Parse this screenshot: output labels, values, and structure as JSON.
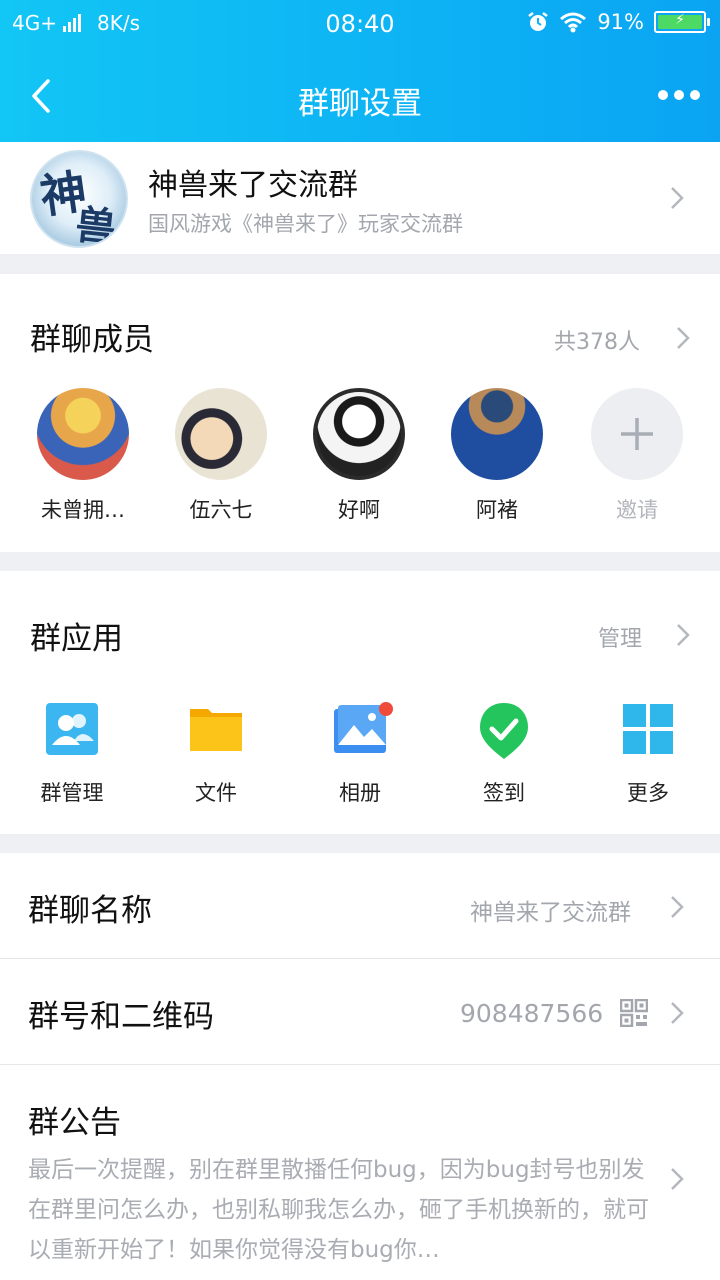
{
  "status_bar": {
    "network": "4G+",
    "speed": "8K/s",
    "time": "08:40",
    "battery": "91%",
    "icons": [
      "signal-icon",
      "alarm-icon",
      "wifi-icon",
      "battery-icon"
    ]
  },
  "nav": {
    "title": "群聊设置",
    "back_icon": "back-arrow-icon",
    "more_icon": "more-dots-icon"
  },
  "group": {
    "name": "神兽来了交流群",
    "description": "国风游戏《神兽来了》玩家交流群",
    "avatar_glyphs": [
      "神",
      "兽"
    ]
  },
  "members": {
    "title": "群聊成员",
    "count": "共378人",
    "list": [
      {
        "name": "未曾拥…",
        "avatar": "avatar-cartoon-racer"
      },
      {
        "name": "伍六七",
        "avatar": "avatar-cartoon-ninja"
      },
      {
        "name": "好啊",
        "avatar": "avatar-manga-suit"
      },
      {
        "name": "阿褚",
        "avatar": "avatar-photo-jacket"
      }
    ],
    "invite_label": "邀请"
  },
  "apps": {
    "title": "群应用",
    "manage": "管理",
    "items": [
      {
        "label": "群管理",
        "icon": "group-manage-icon"
      },
      {
        "label": "文件",
        "icon": "folder-icon"
      },
      {
        "label": "相册",
        "icon": "photo-album-icon"
      },
      {
        "label": "签到",
        "icon": "check-in-icon"
      },
      {
        "label": "更多",
        "icon": "grid-more-icon"
      }
    ]
  },
  "settings": {
    "name_label": "群聊名称",
    "name_value": "神兽来了交流群",
    "number_label": "群号和二维码",
    "number_value": "908487566",
    "qr_icon": "qr-code-icon",
    "notice_label": "群公告",
    "notice_text": "最后一次提醒，别在群里散播任何bug，因为bug封号也别发在群里问怎么办，也别私聊我怎么办，砸了手机换新的，就可以重新开始了！如果你觉得没有bug你…"
  },
  "colors": {
    "header_start": "#12c6f5",
    "header_end": "#0aa4f3",
    "badge": "#f04b3a",
    "checkin_green": "#24c55c",
    "app_blue": "#3bb6f0",
    "folder_yellow": "#fcc419"
  }
}
